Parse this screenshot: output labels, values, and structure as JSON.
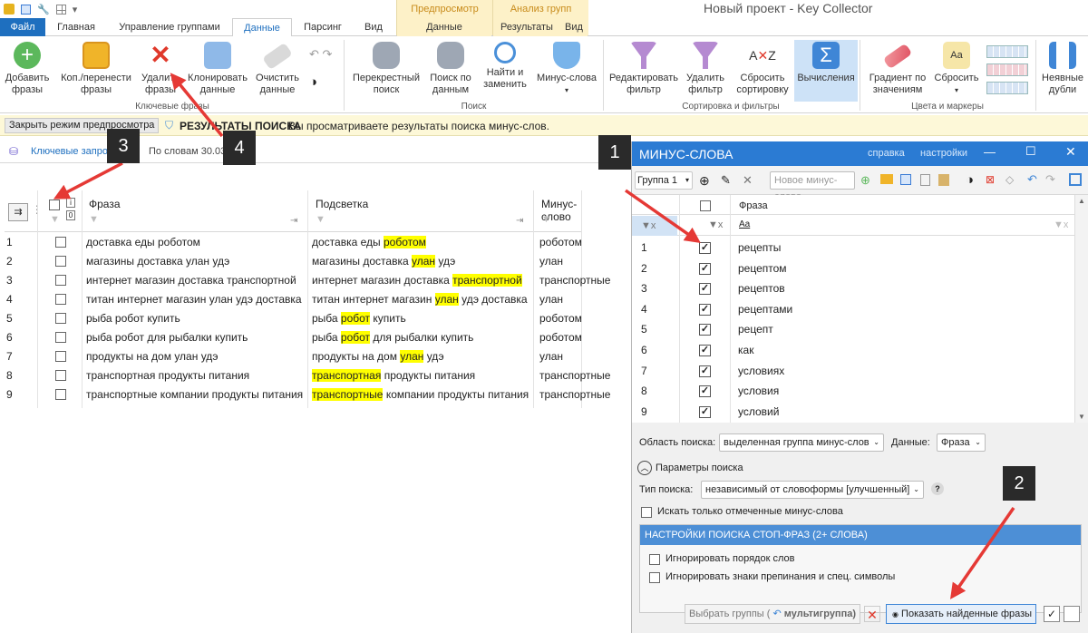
{
  "app": {
    "title": "Новый проект - Key Collector",
    "context_groups": [
      "Предпросмотр",
      "Анализ групп"
    ]
  },
  "tabs": [
    "Файл",
    "Главная",
    "Управление группами",
    "Данные",
    "Парсинг",
    "Вид",
    "Данные",
    "Результаты",
    "Вид"
  ],
  "ribbon": {
    "buttons": [
      {
        "label": "Добавить фразы"
      },
      {
        "label": "Коп./перенести фразы"
      },
      {
        "label": "Удалить фразы"
      },
      {
        "label": "Клонировать данные"
      },
      {
        "label": "Очистить данные"
      },
      {
        "label": "Перекрестный поиск"
      },
      {
        "label": "Поиск по данным"
      },
      {
        "label": "Найти и заменить"
      },
      {
        "label": "Минус-слова"
      },
      {
        "label": "Редактировать фильтр"
      },
      {
        "label": "Удалить фильтр"
      },
      {
        "label": "Сбросить сортировку"
      },
      {
        "label": "Вычисления"
      },
      {
        "label": "Градиент по значениям"
      },
      {
        "label": "Сбросить"
      },
      {
        "label": "Неявные дубли"
      }
    ],
    "groups": [
      "Ключевые фразы",
      "Поиск",
      "Сортировка и фильтры",
      "Цвета и маркеры"
    ]
  },
  "infobar": {
    "close_button": "Закрыть режим предпросмотра",
    "heading": "РЕЗУЛЬТАТЫ ПОИСКА",
    "text": "Вы просматриваете результаты поиска минус-слов."
  },
  "left": {
    "tab1": "Ключевые запросы",
    "tab2": "По словам 30.03",
    "columns": [
      "Фраза",
      "Подсветка",
      "Минус-слово"
    ],
    "rows": [
      {
        "n": "1",
        "phrase": "доставка еды роботом",
        "pre": "доставка еды ",
        "hl": "роботом",
        "post": "",
        "minus": "роботом"
      },
      {
        "n": "2",
        "phrase": "магазины доставка улан удэ",
        "pre": "магазины доставка ",
        "hl": "улан",
        "post": " удэ",
        "minus": "улан"
      },
      {
        "n": "3",
        "phrase": "интернет магазин доставка транспортной",
        "pre": "интернет магазин доставка ",
        "hl": "транспортной",
        "post": "",
        "minus": "транспортные"
      },
      {
        "n": "4",
        "phrase": "титан интернет магазин улан удэ доставка",
        "pre": "титан интернет магазин ",
        "hl": "улан",
        "post": " удэ доставка",
        "minus": "улан"
      },
      {
        "n": "5",
        "phrase": "рыба робот купить",
        "pre": "рыба ",
        "hl": "робот",
        "post": " купить",
        "minus": "роботом"
      },
      {
        "n": "6",
        "phrase": "рыба робот для рыбалки купить",
        "pre": "рыба ",
        "hl": "робот",
        "post": " для рыбалки купить",
        "minus": "роботом"
      },
      {
        "n": "7",
        "phrase": "продукты на дом улан удэ",
        "pre": "продукты на дом ",
        "hl": "улан",
        "post": " удэ",
        "minus": "улан"
      },
      {
        "n": "8",
        "phrase": "транспортная продукты питания",
        "pre": "",
        "hl": "транспортная",
        "post": " продукты питания",
        "minus": "транспортные"
      },
      {
        "n": "9",
        "phrase": "транспортные компании продукты питания",
        "pre": "",
        "hl": "транспортные",
        "post": " компании продукты питания",
        "minus": "транспортные"
      }
    ]
  },
  "right": {
    "title": "МИНУС-СЛОВА",
    "help": "справка",
    "settings": "настройки",
    "group_select": "Группа 1",
    "new_word_placeholder": "Новое минус-слово",
    "column": "Фраза",
    "filter_hint": "Aa",
    "rows": [
      {
        "n": "1",
        "t": "рецепты"
      },
      {
        "n": "2",
        "t": "рецептом"
      },
      {
        "n": "3",
        "t": "рецептов"
      },
      {
        "n": "4",
        "t": "рецептами"
      },
      {
        "n": "5",
        "t": "рецепт"
      },
      {
        "n": "6",
        "t": "как"
      },
      {
        "n": "7",
        "t": "условиях"
      },
      {
        "n": "8",
        "t": "условия"
      },
      {
        "n": "9",
        "t": "условий"
      }
    ],
    "area_label": "Область поиска:",
    "area_value": "выделенная группа минус-слов",
    "data_label": "Данные:",
    "data_value": "Фраза",
    "params_label": "Параметры поиска",
    "type_label": "Тип поиска:",
    "type_value": "независимый от словоформы [улучшенный]",
    "only_checked": "Искать только отмеченные минус-слова",
    "stop_header": "НАСТРОЙКИ ПОИСКА СТОП-ФРАЗ (2+ СЛОВА)",
    "ignore_order": "Игнорировать порядок слов",
    "ignore_punct": "Игнорировать знаки препинания и спец. символы",
    "select_groups_a": "Выбрать группы (",
    "select_groups_b": "мультигруппа)",
    "show_found": "Показать найденные фразы"
  },
  "callouts": [
    "1",
    "2",
    "3",
    "4"
  ],
  "colors": {
    "accent": "#1e6fbf",
    "highlight": "#ffff00",
    "arrow": "#e53935",
    "panel_header": "#2b7bd3"
  }
}
